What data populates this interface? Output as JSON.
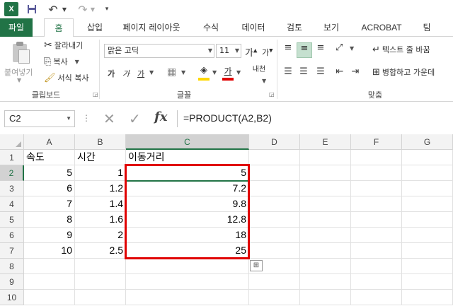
{
  "qat": {
    "excel_letter": "X"
  },
  "tabs": [
    "파일",
    "홈",
    "삽입",
    "페이지 레이아웃",
    "수식",
    "데이터",
    "검토",
    "보기",
    "ACROBAT",
    "팀"
  ],
  "clipboard": {
    "paste_label": "붙여넣기",
    "cut_label": "잘라내기",
    "copy_label": "복사",
    "format_painter_label": "서식 복사",
    "group_label": "클립보드"
  },
  "font": {
    "font_name": "맑은 고딕",
    "font_size": "11",
    "grow_glyph": "가",
    "shrink_glyph": "가",
    "bold_glyph": "가",
    "italic_glyph": "가",
    "underline_glyph": "가",
    "font_color_glyph": "가",
    "phonetic_glyph": "내천",
    "group_label": "글꼴"
  },
  "alignment": {
    "wrap_text_label": "텍스트 줄 바꿈",
    "merge_center_label": "병합하고 가운데",
    "group_label": "맞춤"
  },
  "formula_bar": {
    "name_box": "C2",
    "formula": "=PRODUCT(A2,B2)"
  },
  "grid": {
    "columns": [
      "A",
      "B",
      "C",
      "D",
      "E",
      "F",
      "G"
    ],
    "rows": [
      "1",
      "2",
      "3",
      "4",
      "5",
      "6",
      "7",
      "8",
      "9",
      "10"
    ],
    "cells": [
      [
        "속도",
        "시간",
        "이동거리"
      ],
      [
        "5",
        "1",
        "5"
      ],
      [
        "6",
        "1.2",
        "7.2"
      ],
      [
        "7",
        "1.4",
        "9.8"
      ],
      [
        "8",
        "1.6",
        "12.8"
      ],
      [
        "9",
        "2",
        "18"
      ],
      [
        "10",
        "2.5",
        "25"
      ]
    ]
  },
  "colors": {
    "accent": "#217346",
    "highlight": "#e00000"
  }
}
